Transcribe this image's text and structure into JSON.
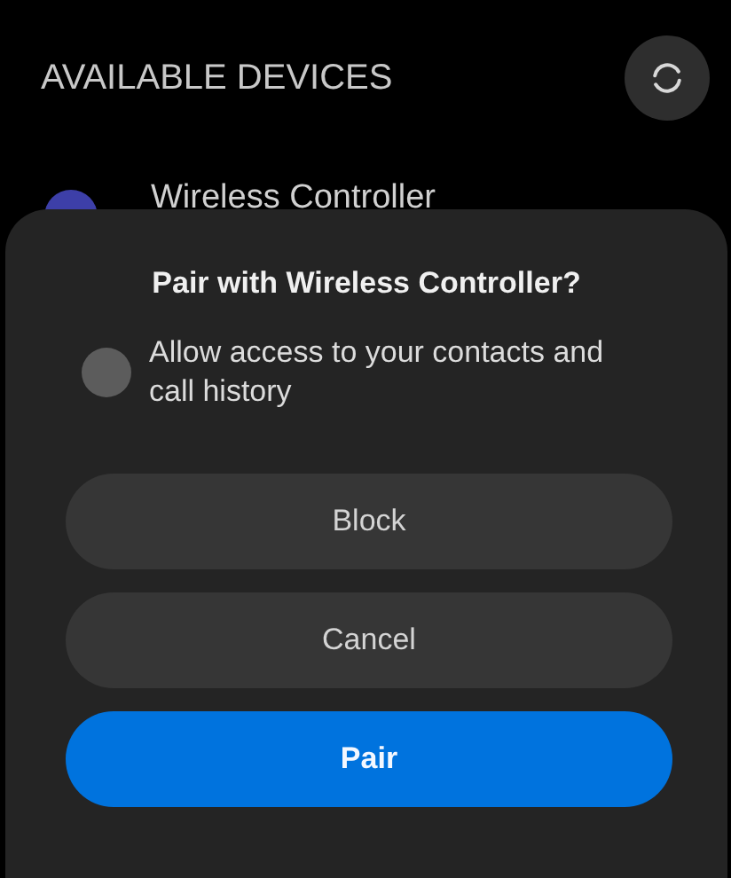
{
  "header": {
    "title": "AVAILABLE DEVICES"
  },
  "devices": [
    {
      "name": "Wireless Controller",
      "color": "#3d3fa8"
    }
  ],
  "dialog": {
    "title": "Pair with Wireless Controller?",
    "option": {
      "label": "Allow access to your contacts and call history",
      "checked": false
    },
    "buttons": [
      {
        "label": "Block",
        "kind": "secondary"
      },
      {
        "label": "Cancel",
        "kind": "secondary"
      },
      {
        "label": "Pair",
        "kind": "primary"
      }
    ]
  }
}
